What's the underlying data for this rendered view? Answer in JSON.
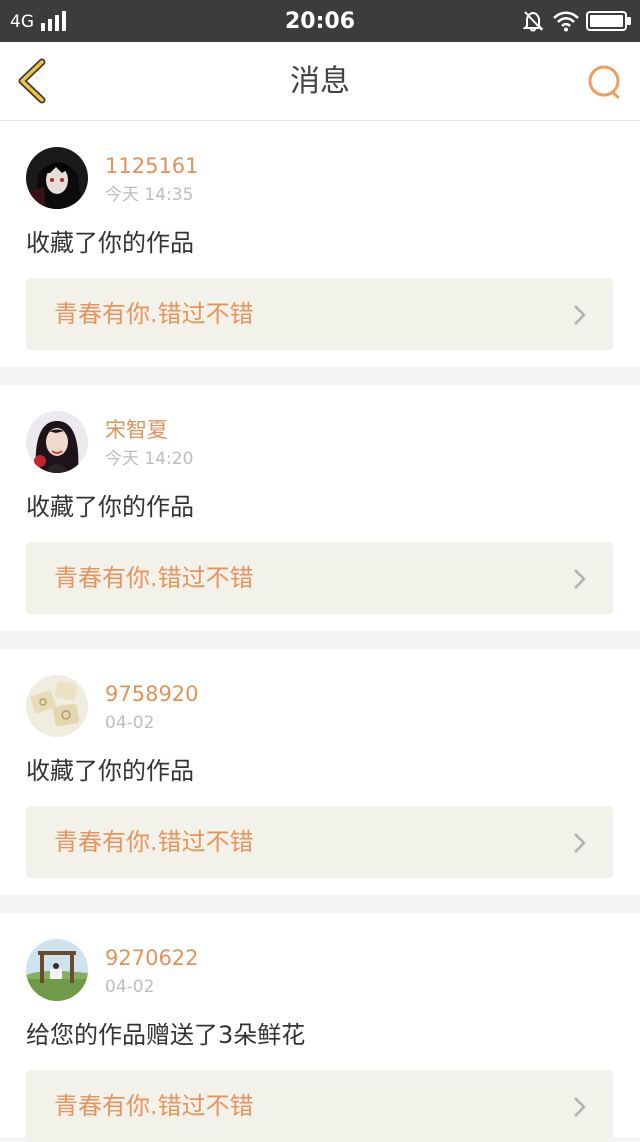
{
  "status_bar": {
    "network": "4G",
    "time": "20:06"
  },
  "header": {
    "title": "消息"
  },
  "messages": [
    {
      "username": "1125161",
      "time": "今天 14:35",
      "action": "收藏了你的作品",
      "work_title": "青春有你.错过不错"
    },
    {
      "username": "宋智夏",
      "time": "今天 14:20",
      "action": "收藏了你的作品",
      "work_title": "青春有你.错过不错"
    },
    {
      "username": "9758920",
      "time": "04-02",
      "action": "收藏了你的作品",
      "work_title": "青春有你.错过不错"
    },
    {
      "username": "9270622",
      "time": "04-02",
      "action": "给您的作品赠送了3朵鲜花",
      "work_title": "青春有你.错过不错"
    }
  ],
  "colors": {
    "accent": "#e6955c",
    "back_arrow": "#e8b53a",
    "status_bar": "#3c3c3c"
  },
  "icons": {
    "back": "back-chevron-icon",
    "search": "search-icon",
    "mute": "bell-muted-icon",
    "wifi": "wifi-icon",
    "battery": "battery-icon",
    "signal": "signal-bars-icon",
    "chevron": "chevron-right-icon"
  }
}
